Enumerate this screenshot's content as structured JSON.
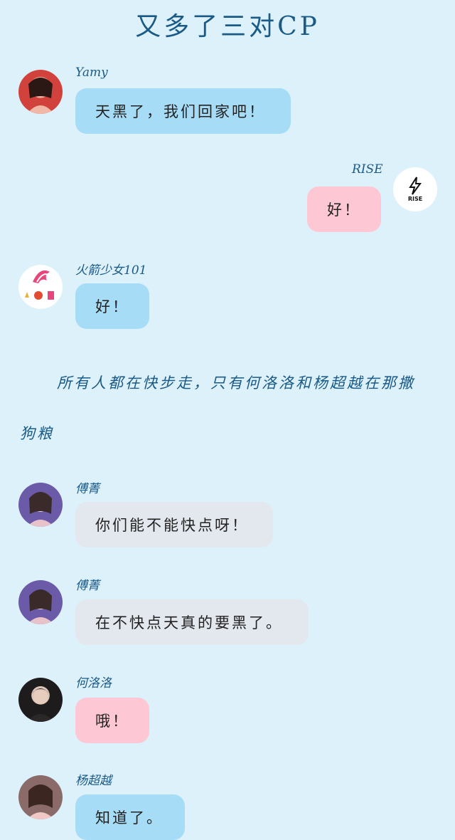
{
  "title": "又多了三对CP",
  "narration": {
    "line1": "所有人都在快步走，只有何洛洛和杨超越在那撒",
    "line2": "狗粮"
  },
  "messages": [
    {
      "name": "Yamy",
      "text": "天黑了，我们回家吧！",
      "color": "#a6dcf6"
    },
    {
      "name": "RISE",
      "text": "好！",
      "color": "#fdc8d4",
      "avatar_text": "RISE"
    },
    {
      "name": "火箭少女101",
      "text": "好！",
      "color": "#a6dcf6"
    },
    {
      "name": "傅菁",
      "text": "你们能不能快点呀！",
      "color": "#e3e7ee"
    },
    {
      "name": "傅菁",
      "text": "在不快点天真的要黑了。",
      "color": "#e3e7ee"
    },
    {
      "name": "何洛洛",
      "text": "哦！",
      "color": "#fdc8d4"
    },
    {
      "name": "杨超越",
      "text": "知道了。",
      "color": "#a6dcf6"
    }
  ]
}
